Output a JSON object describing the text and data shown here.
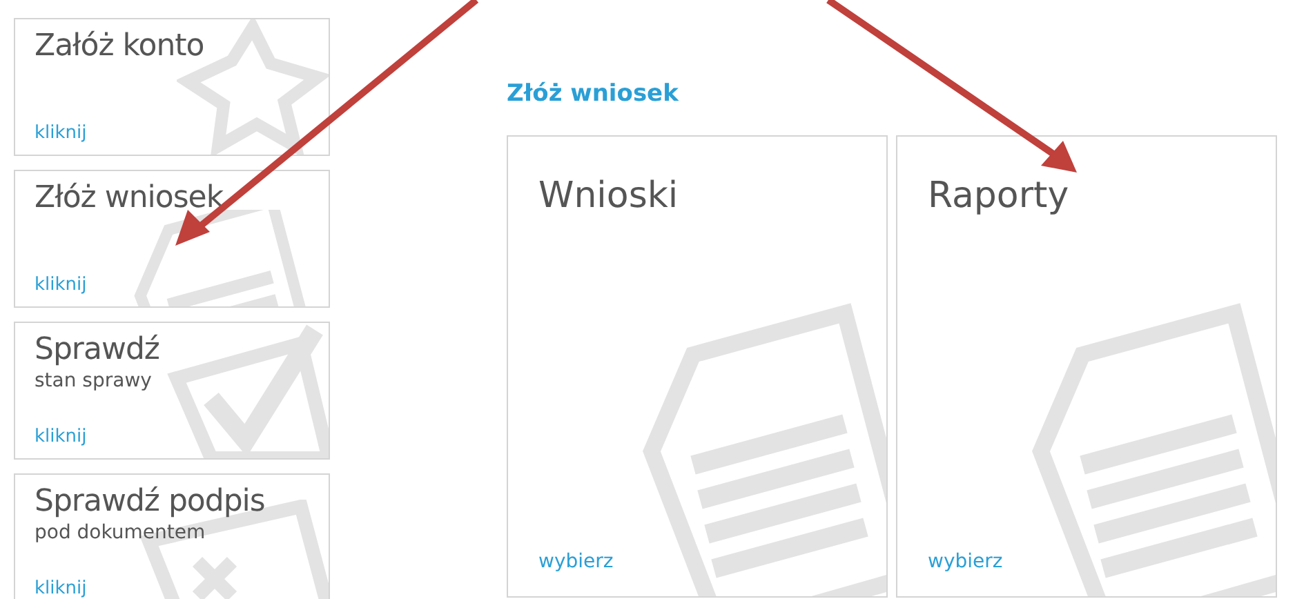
{
  "side_tiles": [
    {
      "title": "Załóż konto",
      "link": "kliknij",
      "kind": "star"
    },
    {
      "title": "Złóż wniosek",
      "link": "kliknij",
      "kind": "document"
    },
    {
      "title": "Sprawdź",
      "subtitle": "stan sprawy",
      "link": "kliknij",
      "kind": "check"
    },
    {
      "title": "Sprawdź podpis",
      "subtitle": "pod dokumentem",
      "link": "kliknij",
      "kind": "document-x"
    }
  ],
  "section": {
    "heading": "Złóż wniosek",
    "tiles": [
      {
        "title": "Wnioski",
        "link": "wybierz"
      },
      {
        "title": "Raporty",
        "link": "wybierz"
      }
    ]
  }
}
